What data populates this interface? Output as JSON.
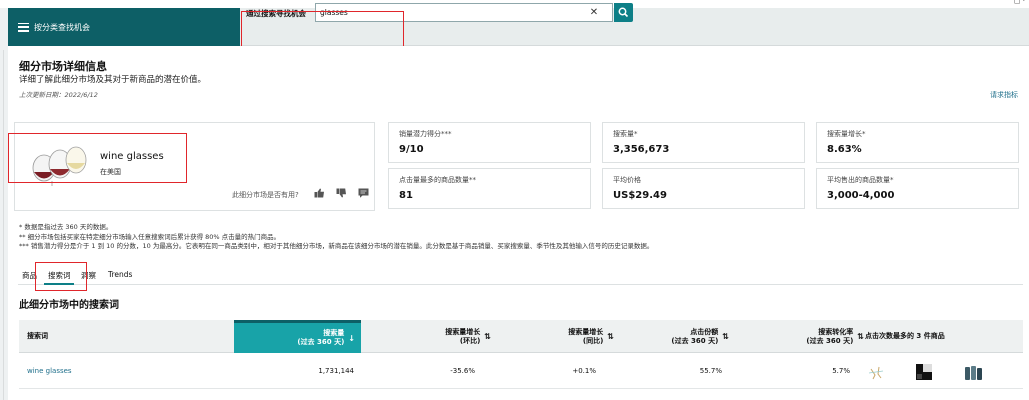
{
  "nav": {
    "category_label": "按分类查找机会",
    "search_label": "通过搜索寻找机会",
    "search_value": "glasses"
  },
  "page": {
    "title": "细分市场详细信息",
    "subtitle": "详细了解此细分市场及其对于新商品的潜在价值。",
    "updated": "上次更新日期：2022/6/12",
    "request_link": "请求指标"
  },
  "product": {
    "name": "wine glasses",
    "region": "在美国",
    "useful_prompt": "此细分市场是否有用?"
  },
  "metrics": [
    {
      "label": "销量潜力得分***",
      "value": "9/10"
    },
    {
      "label": "搜索量*",
      "value": "3,356,673"
    },
    {
      "label": "搜索量增长*",
      "value": "8.63%"
    },
    {
      "label": "点击量最多的商品数量**",
      "value": "81"
    },
    {
      "label": "平均价格",
      "value": "US$29.49"
    },
    {
      "label": "平均售出的商品数量*",
      "value": "3,000-4,000"
    }
  ],
  "notes": [
    "* 数据是指过去 360 天的数据。",
    "** 细分市场包括买家在特定细分市场输入任意搜索词后累计获得 80% 点击量的热门商品。",
    "*** 销售潜力得分是介于 1 到 10 的分数，10 为最高分。它表明在同一商品类别中，相对于其他细分市场，新商品在该细分市场的潜在销量。此分数是基于商品销量、买家搜索量、季节性及其他输入信号的历史记录数据。"
  ],
  "tabs": [
    "商品",
    "搜索词",
    "洞察",
    "Trends"
  ],
  "section_title": "此细分市场中的搜索词",
  "table": {
    "headers": {
      "term": "搜索词",
      "volume_1": "搜索量",
      "volume_2": "(过去 360 天)",
      "growth_1": "搜索量增长",
      "growth_2": "(环比)",
      "growth_q_1": "搜索量增长",
      "growth_q_2": "(同比)",
      "share_1": "点击份额",
      "share_2": "(过去 360 天)",
      "conv_1": "搜索转化率",
      "conv_2": "(过去 360 天)",
      "top3": "点击次数最多的 3 件商品"
    },
    "rows": [
      {
        "term": "wine glasses",
        "volume": "1,731,144",
        "growth": "-35.6%",
        "growth_q": "+0.1%",
        "share": "55.7%",
        "conv": "5.7%"
      }
    ]
  },
  "colors": {
    "teal_dark": "#0d5f66",
    "teal": "#18a3a8",
    "highlight": "#e0262b"
  }
}
